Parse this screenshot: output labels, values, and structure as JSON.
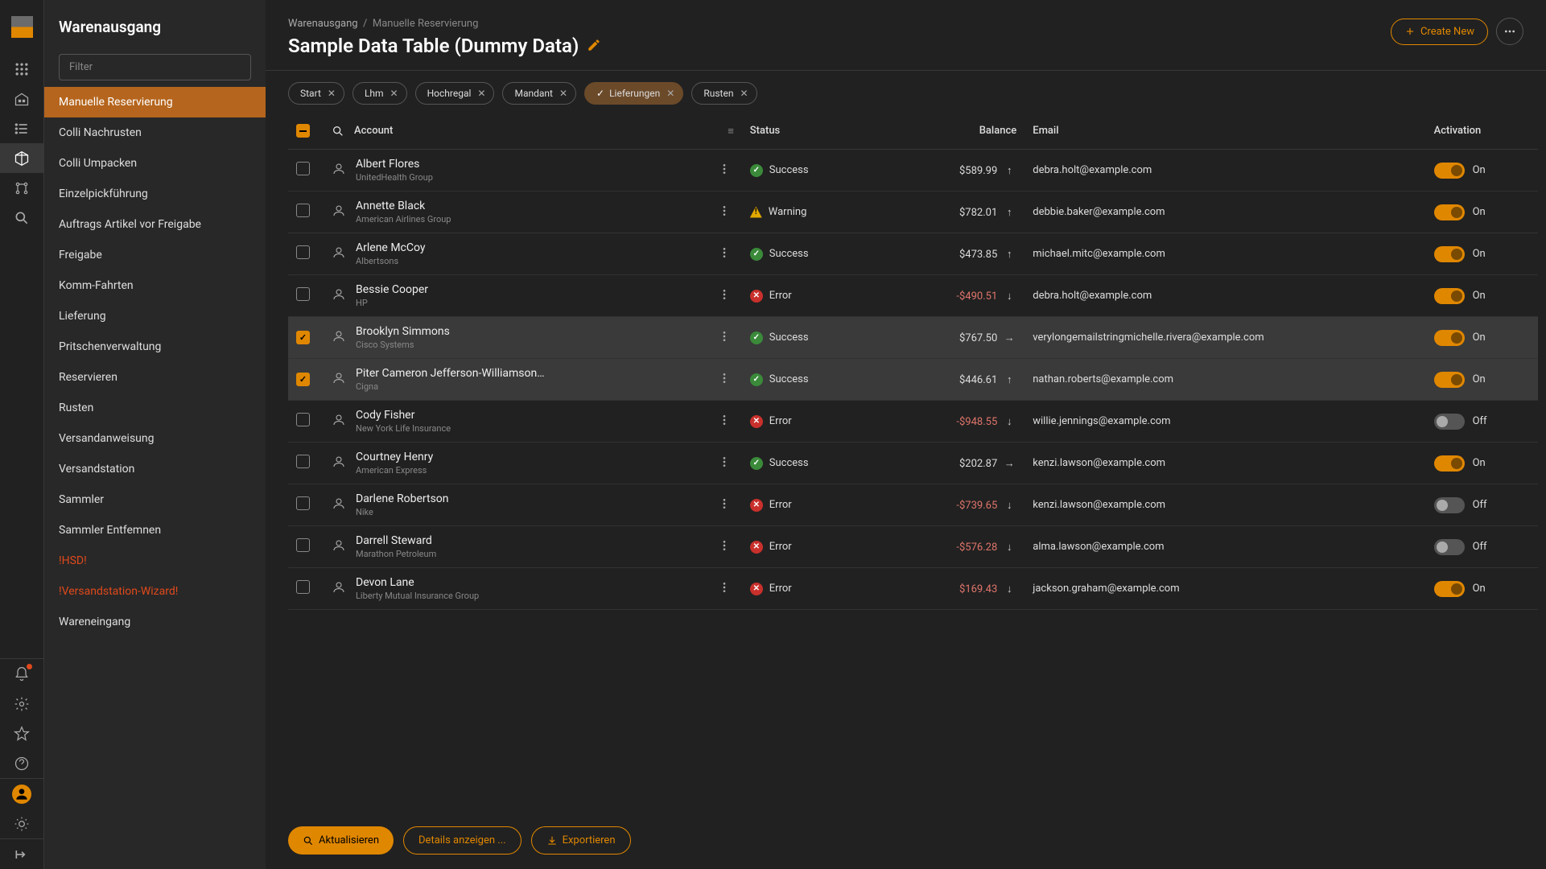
{
  "app": {
    "section_title": "Warenausgang"
  },
  "breadcrumb": {
    "root": "Warenausgang",
    "current": "Manuelle Reservierung"
  },
  "page": {
    "title": "Sample Data Table (Dummy Data)"
  },
  "actions": {
    "create_new": "Create New"
  },
  "filter": {
    "placeholder": "Filter"
  },
  "sidebar": {
    "items": [
      {
        "label": "Manuelle Reservierung",
        "warn": false
      },
      {
        "label": "Colli Nachrusten",
        "warn": false
      },
      {
        "label": "Colli Umpacken",
        "warn": false
      },
      {
        "label": "Einzelpickführung",
        "warn": false
      },
      {
        "label": "Auftrags Artikel vor Freigabe",
        "warn": false
      },
      {
        "label": "Freigabe",
        "warn": false
      },
      {
        "label": "Komm-Fahrten",
        "warn": false
      },
      {
        "label": "Lieferung",
        "warn": false
      },
      {
        "label": "Pritschenverwaltung",
        "warn": false
      },
      {
        "label": "Reservieren",
        "warn": false
      },
      {
        "label": "Rusten",
        "warn": false
      },
      {
        "label": "Versandanweisung",
        "warn": false
      },
      {
        "label": "Versandstation",
        "warn": false
      },
      {
        "label": "Sammler",
        "warn": false
      },
      {
        "label": "Sammler Entfemnen",
        "warn": false
      },
      {
        "label": "!HSD!",
        "warn": true
      },
      {
        "label": "!Versandstation-Wizard!",
        "warn": true
      },
      {
        "label": "Wareneingang",
        "warn": false
      }
    ],
    "active_index": 0
  },
  "chips": [
    {
      "label": "Start",
      "active": false
    },
    {
      "label": "Lhm",
      "active": false
    },
    {
      "label": "Hochregal",
      "active": false
    },
    {
      "label": "Mandant",
      "active": false
    },
    {
      "label": "Lieferungen",
      "active": true
    },
    {
      "label": "Rusten",
      "active": false
    }
  ],
  "table": {
    "headers": {
      "account": "Account",
      "status": "Status",
      "balance": "Balance",
      "email": "Email",
      "activation": "Activation"
    },
    "rows": [
      {
        "name": "Albert Flores",
        "company": "UnitedHealth Group",
        "status": "Success",
        "status_type": "success",
        "balance_text": "$589.99",
        "balance_neg": false,
        "arrow": "up",
        "email": "debra.holt@example.com",
        "toggle_on": true,
        "toggle_label": "On",
        "selected": false
      },
      {
        "name": "Annette Black",
        "company": "American Airlines Group",
        "status": "Warning",
        "status_type": "warning",
        "balance_text": "$782.01",
        "balance_neg": false,
        "arrow": "up",
        "email": "debbie.baker@example.com",
        "toggle_on": true,
        "toggle_label": "On",
        "selected": false
      },
      {
        "name": "Arlene McCoy",
        "company": "Albertsons",
        "status": "Success",
        "status_type": "success",
        "balance_text": "$473.85",
        "balance_neg": false,
        "arrow": "up",
        "email": "michael.mitc@example.com",
        "toggle_on": true,
        "toggle_label": "On",
        "selected": false
      },
      {
        "name": "Bessie Cooper",
        "company": "HP",
        "status": "Error",
        "status_type": "error",
        "balance_text": "-$490.51",
        "balance_neg": true,
        "arrow": "down",
        "email": "debra.holt@example.com",
        "toggle_on": true,
        "toggle_label": "On",
        "selected": false
      },
      {
        "name": "Brooklyn Simmons",
        "company": "Cisco Systems",
        "status": "Success",
        "status_type": "success",
        "balance_text": "$767.50",
        "balance_neg": false,
        "arrow": "right",
        "email": "verylongemailstringmichelle.rivera@example.com",
        "toggle_on": true,
        "toggle_label": "On",
        "selected": true
      },
      {
        "name": "Piter Cameron Jefferson-Williamson…",
        "company": "Cigna",
        "status": "Success",
        "status_type": "success",
        "balance_text": "$446.61",
        "balance_neg": false,
        "arrow": "up",
        "email": "nathan.roberts@example.com",
        "toggle_on": true,
        "toggle_label": "On",
        "selected": true
      },
      {
        "name": "Cody Fisher",
        "company": "New York Life Insurance",
        "status": "Error",
        "status_type": "error",
        "balance_text": "-$948.55",
        "balance_neg": true,
        "arrow": "down",
        "email": "willie.jennings@example.com",
        "toggle_on": false,
        "toggle_label": "Off",
        "selected": false
      },
      {
        "name": "Courtney Henry",
        "company": "American Express",
        "status": "Success",
        "status_type": "success",
        "balance_text": "$202.87",
        "balance_neg": false,
        "arrow": "right",
        "email": "kenzi.lawson@example.com",
        "toggle_on": true,
        "toggle_label": "On",
        "selected": false
      },
      {
        "name": "Darlene Robertson",
        "company": "Nike",
        "status": "Error",
        "status_type": "error",
        "balance_text": "-$739.65",
        "balance_neg": true,
        "arrow": "down",
        "email": "kenzi.lawson@example.com",
        "toggle_on": false,
        "toggle_label": "Off",
        "selected": false
      },
      {
        "name": "Darrell Steward",
        "company": "Marathon Petroleum",
        "status": "Error",
        "status_type": "error",
        "balance_text": "-$576.28",
        "balance_neg": true,
        "arrow": "down",
        "email": "alma.lawson@example.com",
        "toggle_on": false,
        "toggle_label": "Off",
        "selected": false
      },
      {
        "name": "Devon Lane",
        "company": "Liberty Mutual Insurance Group",
        "status": "Error",
        "status_type": "error",
        "balance_text": "$169.43",
        "balance_neg": true,
        "arrow": "down",
        "email": "jackson.graham@example.com",
        "toggle_on": true,
        "toggle_label": "On",
        "selected": false
      }
    ]
  },
  "footer": {
    "refresh": "Aktualisieren",
    "details": "Details anzeigen ...",
    "export": "Exportieren"
  }
}
